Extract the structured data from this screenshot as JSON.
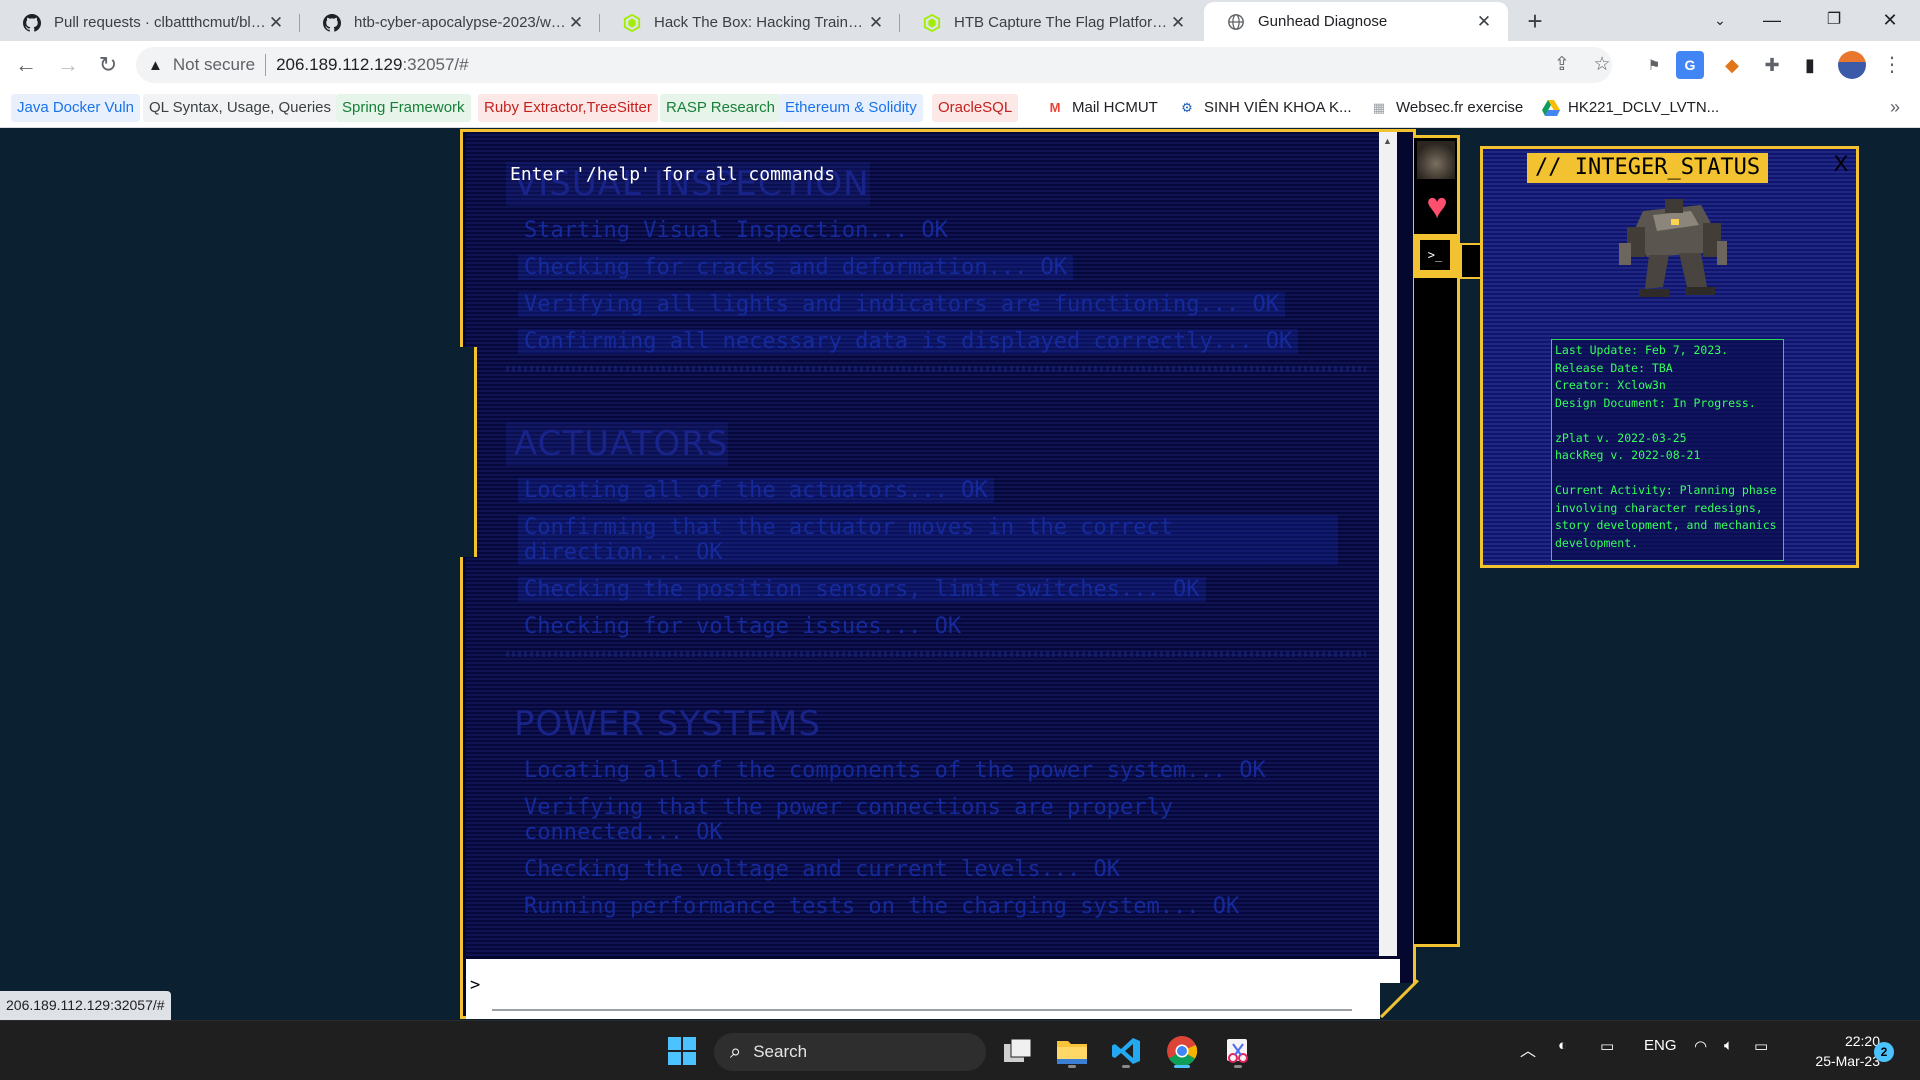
{
  "browser": {
    "tabs": [
      {
        "title": "Pull requests · clbattthcmut/blog",
        "icon": "github-icon"
      },
      {
        "title": "htb-cyber-apocalypse-2023/web",
        "icon": "github-icon"
      },
      {
        "title": "Hack The Box: Hacking Training F",
        "icon": "htb-icon"
      },
      {
        "title": "HTB Capture The Flag Platform | I",
        "icon": "htb-icon"
      },
      {
        "title": "Gunhead Diagnose",
        "icon": "globe-icon"
      }
    ],
    "address": {
      "security": "Not secure",
      "host": "206.189.112.129",
      "path": ":32057/#"
    },
    "bookmarks": [
      {
        "label": "Java Docker Vuln",
        "color": "#1a73e8",
        "bg": "#e8f0fe"
      },
      {
        "label": "QL Syntax, Usage, Queries",
        "color": "#3c4043",
        "bg": "#f1f3f4"
      },
      {
        "label": "Spring Framework",
        "color": "#188038",
        "bg": "#e6f4ea"
      },
      {
        "label": "Ruby Extractor,TreeSitter",
        "color": "#c5221f",
        "bg": "#fce8e6"
      },
      {
        "label": "RASP Research",
        "color": "#188038",
        "bg": "#e6f4ea"
      },
      {
        "label": "Ethereum & Solidity",
        "color": "#1a73e8",
        "bg": "#e8f0fe"
      },
      {
        "label": "OracleSQL",
        "color": "#c5221f",
        "bg": "#fce8e6"
      },
      {
        "label": "Mail HCMUT",
        "icon": "gmail-icon"
      },
      {
        "label": "SINH VIÊN KHOA K...",
        "icon": "people-icon"
      },
      {
        "label": "Websec.fr exercise",
        "icon": "websec-icon"
      },
      {
        "label": "HK221_DCLV_LVTN...",
        "icon": "drive-icon"
      }
    ],
    "status_url": "206.189.112.129:32057/#"
  },
  "terminal": {
    "prompt": "Enter '/help' for all commands",
    "input_caret": ">",
    "background_sections": [
      {
        "heading": "VISUAL INSPECTION",
        "lines": [
          "Starting Visual Inspection... OK",
          "Checking for cracks and deformation... OK",
          "Verifying all lights and indicators are functioning... OK",
          "Confirming all necessary data is displayed correctly... OK"
        ]
      },
      {
        "heading": "ACTUATORS",
        "lines": [
          "Locating all of the actuators... OK",
          "Confirming that the actuator moves in the correct direction... OK",
          "Checking the position sensors, limit switches... OK",
          "Checking for voltage issues... OK"
        ]
      },
      {
        "heading": "POWER SYSTEMS",
        "lines": [
          "Locating all of the components of the power system... OK",
          "Verifying that the power connections are properly connected... OK",
          "Checking the voltage and current levels... OK",
          "Running performance tests on the charging system... OK"
        ]
      }
    ]
  },
  "sidenav": {
    "tooltip": "Command",
    "cmd_glyph": ">_"
  },
  "status_panel": {
    "title": "// INTEGER_STATUS",
    "close": "X",
    "info": "Last Update: Feb 7, 2023.\nRelease Date: TBA\nCreator: Xclow3n\nDesign Document: In Progress.\n\nzPlat v. 2022-03-25\nhackReg v. 2022-08-21\n\nCurrent Activity: Planning phase involving character redesigns, story development, and mechanics development."
  },
  "taskbar": {
    "search_label": "Search",
    "language": "ENG",
    "time": "22:20",
    "date": "25-Mar-23",
    "notifications": "2"
  },
  "colors": {
    "accent_yellow": "#f2c230",
    "terminal_bg": "#06073a",
    "page_bg": "#0b2132",
    "info_green": "#35ff5a"
  }
}
